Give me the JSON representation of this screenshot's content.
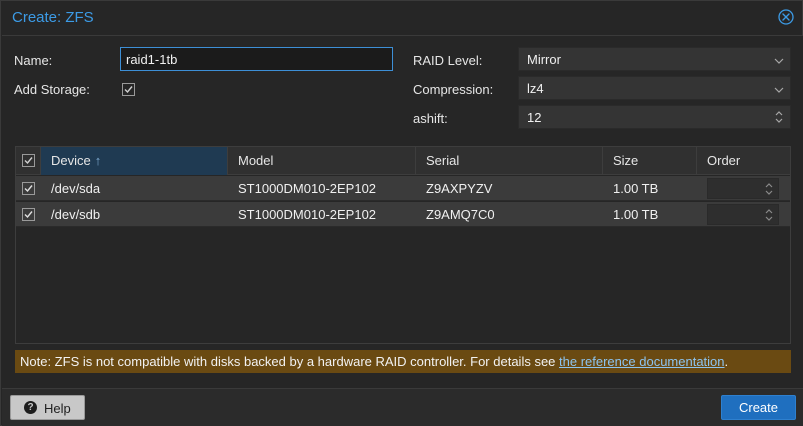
{
  "dialog": {
    "title": "Create: ZFS",
    "close_icon": "close-icon"
  },
  "form": {
    "name_label": "Name:",
    "name_value": "raid1-1tb",
    "add_storage_label": "Add Storage:",
    "add_storage_checked": true,
    "raid_level_label": "RAID Level:",
    "raid_level_value": "Mirror",
    "compression_label": "Compression:",
    "compression_value": "lz4",
    "ashift_label": "ashift:",
    "ashift_value": "12"
  },
  "grid": {
    "columns": [
      "Device",
      "Model",
      "Serial",
      "Size",
      "Order"
    ],
    "sorted_column": "Device",
    "sort_direction": "ascending",
    "rows": [
      {
        "checked": true,
        "device": "/dev/sda",
        "model": "ST1000DM010-2EP102",
        "serial": "Z9AXPYZV",
        "size": "1.00 TB",
        "order": ""
      },
      {
        "checked": true,
        "device": "/dev/sdb",
        "model": "ST1000DM010-2EP102",
        "serial": "Z9AMQ7C0",
        "size": "1.00 TB",
        "order": ""
      }
    ]
  },
  "note": {
    "text": "Note: ZFS is not compatible with disks backed by a hardware RAID controller. For details see ",
    "link_text": "the reference documentation",
    "suffix": "."
  },
  "footer": {
    "help_label": "Help",
    "create_label": "Create"
  },
  "colors": {
    "accent": "#3c9be6",
    "primary_button": "#1f6fbf",
    "note_bg": "#6a4a12"
  }
}
